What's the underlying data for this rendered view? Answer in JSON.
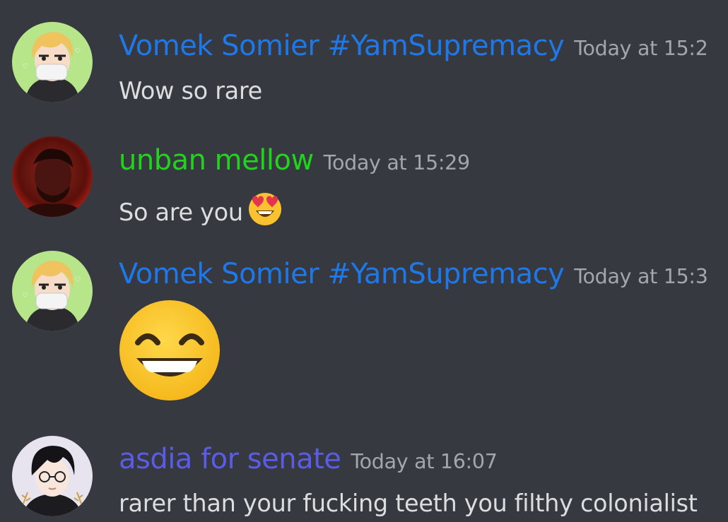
{
  "colors": {
    "background": "#36393f",
    "timestamp": "#a3a6aa",
    "message_text": "#dcddde"
  },
  "messages": [
    {
      "author": "Vomek Somier #YamSupremacy",
      "author_color": "#1f78e8",
      "timestamp": "Today at 15:2",
      "text": "Wow so rare",
      "avatar": "anime-masked-blonde-avatar"
    },
    {
      "author": "unban mellow",
      "author_color": "#22d21e",
      "timestamp": "Today at 15:29",
      "text": "So are you",
      "emoji": "heart-eyes-emoji",
      "avatar": "red-photo-avatar"
    },
    {
      "author": "Vomek Somier #YamSupremacy",
      "author_color": "#1f78e8",
      "timestamp": "Today at 15:3",
      "emoji": "grinning-squinting-emoji",
      "avatar": "anime-masked-blonde-avatar"
    },
    {
      "author": "asdia for senate",
      "author_color": "#5a5ce8",
      "timestamp": "Today at 16:07",
      "text": "rarer than your fucking teeth you filthy colonialist",
      "avatar": "anime-glasses-avatar"
    }
  ]
}
